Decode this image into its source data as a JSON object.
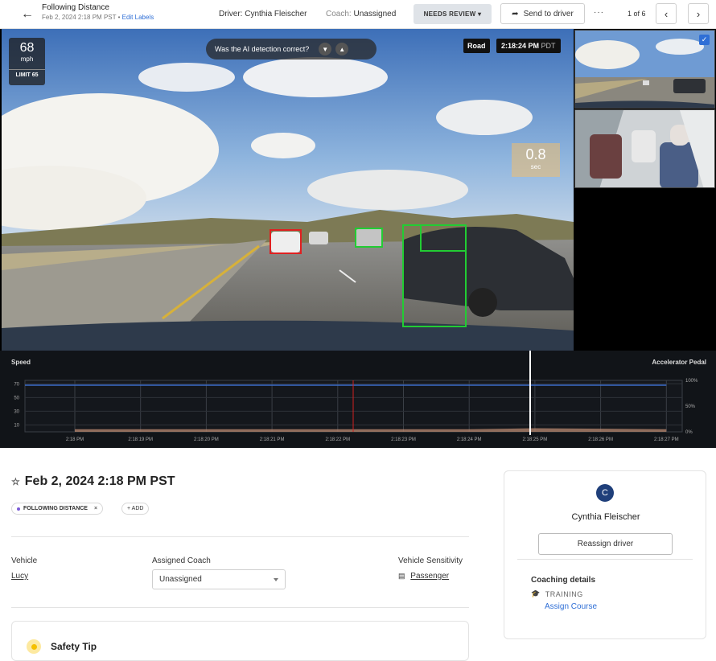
{
  "header": {
    "title": "Following Distance",
    "subtitle": "Feb 2, 2024 2:18 PM PST",
    "edit_labels": "Edit Labels",
    "driver": "Driver: Cynthia Fleischer",
    "coach_label": "Coach:",
    "coach_value": "Unassigned",
    "status_button": "NEEDS REVIEW ▾",
    "send_button": "Send to driver",
    "more": "···",
    "pager": "1 of 6"
  },
  "video": {
    "speed_value": "68",
    "speed_unit": "mph",
    "speed_limit": "LIMIT 65",
    "ai_question": "Was the AI detection correct?",
    "camera_label": "Road",
    "time": "2:18:24 PM",
    "timezone": "PDT",
    "distance_value": "0.8",
    "distance_unit": "sec"
  },
  "chart": {
    "left_label": "Speed",
    "right_label": "Accelerator Pedal",
    "left_ticks": [
      "70",
      "50",
      "30",
      "10"
    ],
    "right_ticks": [
      "100%",
      "50%",
      "0%"
    ],
    "x_ticks": [
      "2:18 PM",
      "2:18:19 PM",
      "2:18:20 PM",
      "2:18:21 PM",
      "2:18:22 PM",
      "2:18:23 PM",
      "2:18:24 PM",
      "2:18:25 PM",
      "2:18:26 PM",
      "2:18:27 PM"
    ]
  },
  "chart_data": {
    "type": "line",
    "x": [
      "2:18 PM",
      "2:18:19 PM",
      "2:18:20 PM",
      "2:18:21 PM",
      "2:18:22 PM",
      "2:18:23 PM",
      "2:18:24 PM",
      "2:18:25 PM",
      "2:18:26 PM",
      "2:18:27 PM"
    ],
    "series": [
      {
        "name": "Speed",
        "values": [
          68,
          68,
          68,
          68,
          68,
          68,
          68,
          68,
          68,
          68
        ]
      },
      {
        "name": "Accelerator Pedal",
        "values": [
          10,
          10,
          10,
          10,
          10,
          10,
          10,
          14,
          12,
          10
        ]
      }
    ],
    "ylim": [
      0,
      75
    ],
    "grid": true
  },
  "event": {
    "title": "Feb 2, 2024 2:18 PM PST",
    "tag": "FOLLOWING DISTANCE",
    "tag_remove": "×",
    "add_tag": "+ ADD"
  },
  "details": {
    "vehicle_label": "Vehicle",
    "vehicle_value": "Lucy",
    "coach_label": "Assigned Coach",
    "coach_value": "Unassigned",
    "sensitivity_label": "Vehicle Sensitivity",
    "sensitivity_value": "Passenger"
  },
  "safety_tip": {
    "title": "Safety Tip"
  },
  "driver_card": {
    "initial": "C",
    "name": "Cynthia Fleischer",
    "reassign": "Reassign driver",
    "coaching_title": "Coaching details",
    "training": "TRAINING",
    "assign_course": "Assign Course"
  },
  "colors": {
    "accent": "#2f6fd6",
    "detection_red": "#e02020",
    "detection_green": "#22cc33",
    "speed_line": "#3b6cc8",
    "pedal_fill": "#b98a70"
  }
}
